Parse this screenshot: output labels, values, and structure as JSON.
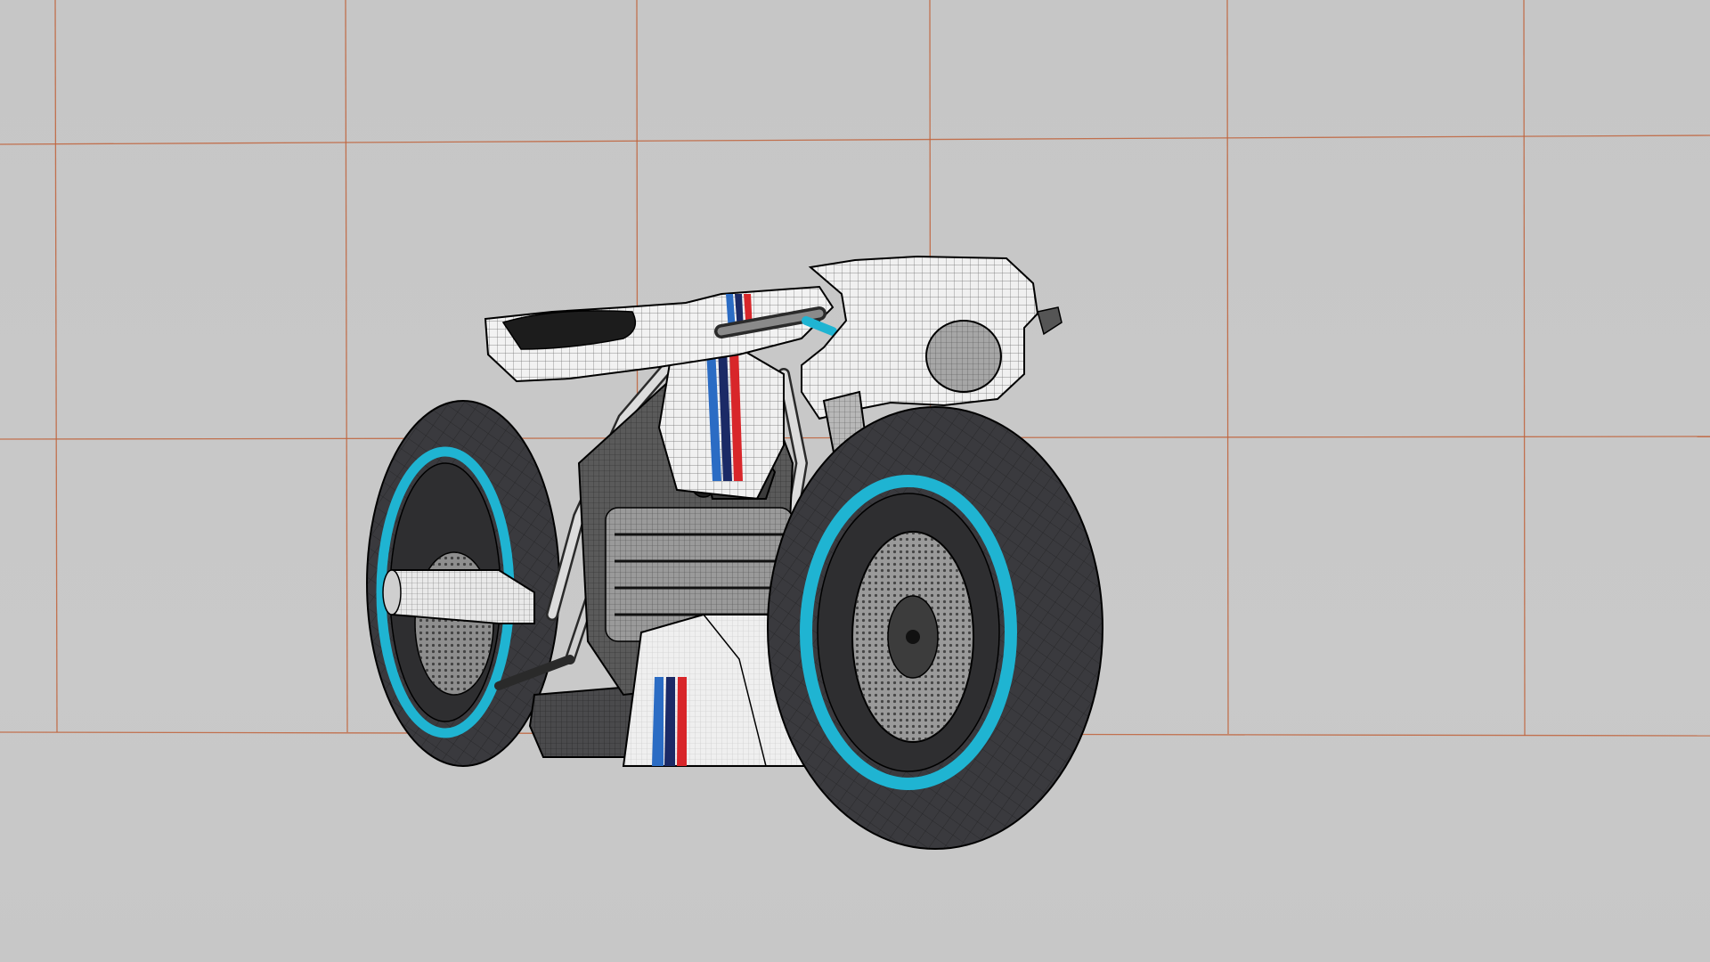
{
  "viewport": {
    "background_color": "#c8c8c8",
    "grid_line_color": "#c0623a",
    "grid_visible": true,
    "shading_mode": "shaded-with-wireframe",
    "edge_color": "#000000"
  },
  "model": {
    "subject": "motorcycle",
    "body_color": "#f0f0f0",
    "tire_color": "#3a3a3e",
    "rim_accent_color": "#1fb4d2",
    "livery_colors": [
      "#2b6cc4",
      "#1b2a66",
      "#d8262a"
    ],
    "engine_color": "#5a5a5a"
  },
  "icons": {
    "grid": "viewport-grid-icon",
    "model": "motorcycle-model-icon"
  }
}
